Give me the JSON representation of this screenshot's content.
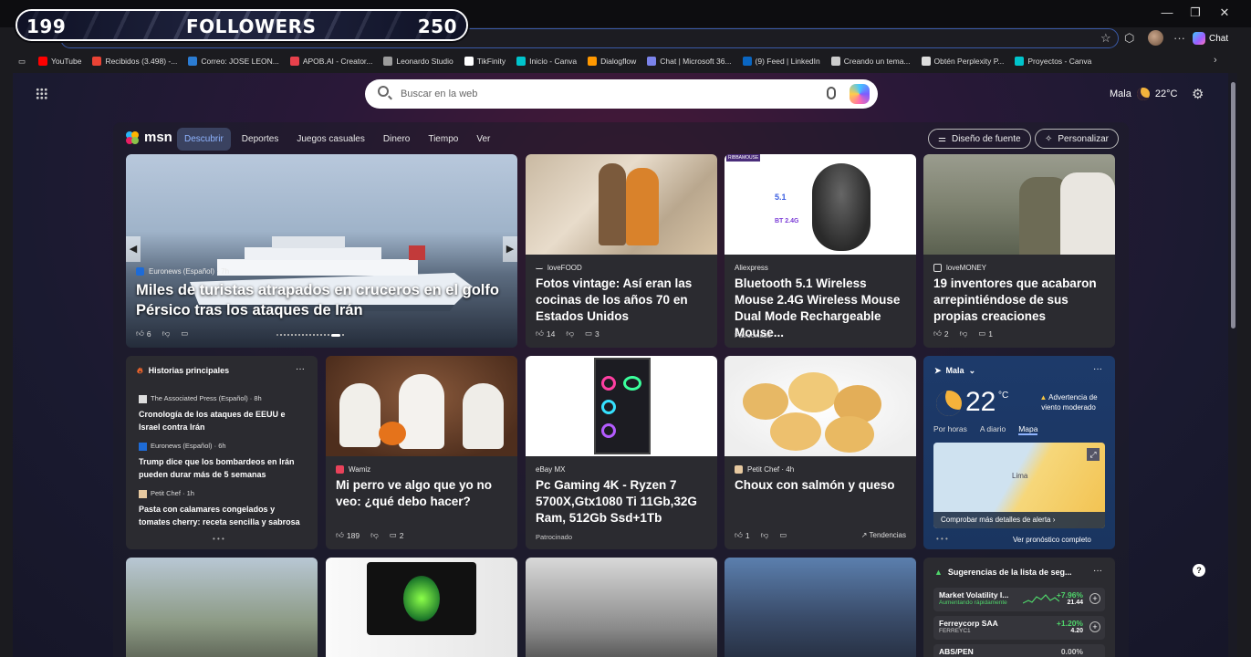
{
  "overlay": {
    "left_count": "199",
    "label": "FOLLOWERS",
    "right_count": "250"
  },
  "browser": {
    "chat_label": "Chat",
    "bookmarks": [
      {
        "label": "YouTube",
        "color": "#ff0000"
      },
      {
        "label": "Recibidos (3.498) -...",
        "color": "#ea4335"
      },
      {
        "label": "Correo: JOSE LEON...",
        "color": "#2b7cd3"
      },
      {
        "label": "APOB.AI - Creator...",
        "color": "#e8414c"
      },
      {
        "label": "Leonardo Studio",
        "color": "#9c9c9c"
      },
      {
        "label": "TikFinity",
        "color": "#ffffff"
      },
      {
        "label": "Inicio - Canva",
        "color": "#00c4cc"
      },
      {
        "label": "Dialogflow",
        "color": "#ff9800"
      },
      {
        "label": "Chat | Microsoft 36...",
        "color": "#7b83eb"
      },
      {
        "label": "(9) Feed | LinkedIn",
        "color": "#0a66c2"
      },
      {
        "label": "Creando un tema...",
        "color": "#cccccc"
      },
      {
        "label": "Obtén Perplexity P...",
        "color": "#dddddd"
      },
      {
        "label": "Proyectos - Canva",
        "color": "#00c4cc"
      }
    ]
  },
  "page": {
    "search_placeholder": "Buscar en la web",
    "location": "Mala",
    "temp": "22°C"
  },
  "msn": {
    "logo": "msn",
    "tabs": [
      "Descubrir",
      "Deportes",
      "Juegos casuales",
      "Dinero",
      "Tiempo",
      "Ver"
    ],
    "font_btn": "Diseño de fuente",
    "personalize_btn": "Personalizar"
  },
  "hero": {
    "source": "Euronews (Español) · 7h",
    "title": "Miles de turistas atrapados en cruceros en el golfo Pérsico tras los ataques de Irán",
    "likes": "6"
  },
  "cards": {
    "kitchen": {
      "source": "loveFOOD",
      "title": "Fotos vintage: Así eran las cocinas de los años 70 en Estados Unidos",
      "likes": "14",
      "comments": "3"
    },
    "mouse": {
      "source": "Aliexpress",
      "title": "Bluetooth 5.1 Wireless Mouse 2.4G Wireless Mouse Dual Mode Rechargeable Mouse...",
      "sponsored": "Patrocinado",
      "img_badge": "RIBBAMOUSE",
      "spec1": "5.1",
      "spec2": "BT 2.4G"
    },
    "inventors": {
      "source": "loveMONEY",
      "title": "19 inventores que acabaron arrepintiéndose de sus propias creaciones",
      "likes": "2",
      "comments": "1"
    },
    "dog": {
      "source": "Wamiz",
      "title": "Mi perro ve algo que yo no veo: ¿qué debo hacer?",
      "likes": "189",
      "comments": "2"
    },
    "pc": {
      "source": "eBay MX",
      "title": "Pc Gaming 4K - Ryzen 7 5700X,Gtx1080 Ti 11Gb,32G Ram, 512Gb Ssd+1Tb",
      "sponsored": "Patrocinado"
    },
    "choux": {
      "source": "Petit Chef · 4h",
      "title": "Choux con salmón y queso",
      "likes": "1",
      "trending": "Tendencias"
    }
  },
  "stories": {
    "header": "Historias principales",
    "items": [
      {
        "source": "The Associated Press (Español) · 8h",
        "title": "Cronología de los ataques de EEUU e Israel contra Irán"
      },
      {
        "source": "Euronews (Español) · 6h",
        "title": "Trump dice que los bombardeos en Irán pueden durar más de 5 semanas"
      },
      {
        "source": "Petit Chef · 1h",
        "title": "Pasta con calamares congelados y tomates cherry: receta sencilla y sabrosa"
      }
    ]
  },
  "weather": {
    "location": "Mala",
    "temp": "22",
    "unit": "°C",
    "alert": "Advertencia de viento moderado",
    "tabs": [
      "Por horas",
      "A diario",
      "Mapa"
    ],
    "map_city": "Lima",
    "map_cta": "Comprobar más detalles de alerta",
    "forecast_link": "Ver pronóstico completo"
  },
  "stocks": {
    "header": "Sugerencias de la lista de seg...",
    "rows": [
      {
        "name": "Market Volatility I...",
        "sub": "Aumentando rápidamente",
        "pct": "+7.96%",
        "value": "21.44"
      },
      {
        "name": "Ferreycorp SAA",
        "sub": "FERREYC1",
        "pct": "+1.20%",
        "value": "4.20"
      },
      {
        "name": "ABS/PEN",
        "sub": "",
        "pct": "0.00%",
        "value": ""
      }
    ]
  }
}
